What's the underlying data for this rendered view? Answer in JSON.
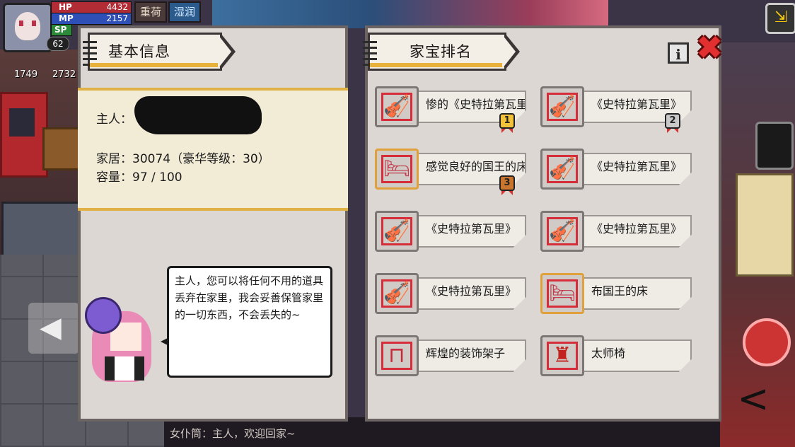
{
  "hud": {
    "hp_label": "HP",
    "hp_value": "4432",
    "mp_label": "MP",
    "mp_value": "2157",
    "sp_label": "SP",
    "level": "62",
    "tag_heavy": "重荷",
    "tag_moist": "湿润",
    "stat1": "1749",
    "stat2": "2732"
  },
  "basic_info": {
    "title": "基本信息",
    "owner_label": "主人：",
    "home_text": "家居：30074（豪华等级：30）",
    "capacity_text": "容量：97 / 100"
  },
  "maid_dialog": "主人，您可以将任何不用的道具丢弃在家里，我会妥善保管家里的一切东西，不会丢失的~",
  "ranking": {
    "title": "家宝排名",
    "info_glyph": "i",
    "close_glyph": "✖",
    "items": [
      {
        "name": "惨的《史特拉第瓦里",
        "icon": "violin-icon",
        "medal": "1"
      },
      {
        "name": "《史特拉第瓦里》",
        "icon": "violin-icon",
        "medal": "2"
      },
      {
        "name": "感觉良好的国王的床",
        "icon": "bed-icon",
        "medal": "3"
      },
      {
        "name": "《史特拉第瓦里》",
        "icon": "violin-icon",
        "medal": ""
      },
      {
        "name": "《史特拉第瓦里》",
        "icon": "violin-icon",
        "medal": ""
      },
      {
        "name": "《史特拉第瓦里》",
        "icon": "violin-icon",
        "medal": ""
      },
      {
        "name": "《史特拉第瓦里》",
        "icon": "violin-icon",
        "medal": ""
      },
      {
        "name": "布国王的床",
        "icon": "bed-icon",
        "medal": ""
      },
      {
        "name": "辉煌的装饰架子",
        "icon": "shelf-icon",
        "medal": ""
      },
      {
        "name": "太师椅",
        "icon": "chair-icon",
        "medal": ""
      }
    ]
  },
  "chat": {
    "line": "女仆筒：主人，欢迎回家~"
  },
  "colors": {
    "panel": "#dcd7d2",
    "accent_gold": "#e0b245",
    "close_red": "#e23030"
  }
}
